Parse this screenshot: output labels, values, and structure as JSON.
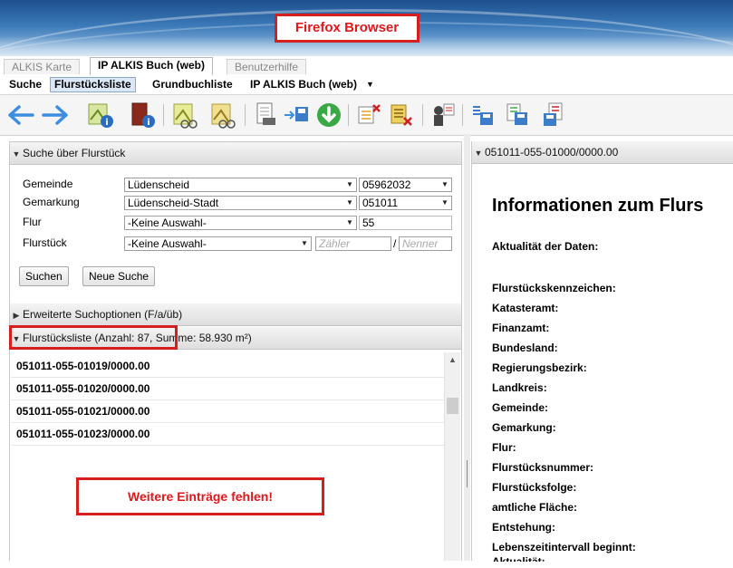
{
  "browser": {
    "label": "Firefox Browser"
  },
  "tabs": [
    {
      "label": "ALKIS Karte"
    },
    {
      "label": "IP ALKIS Buch (web)"
    },
    {
      "label": "Benutzerhilfe"
    }
  ],
  "menu": {
    "items": [
      "Suche",
      "Flurstücksliste",
      "Grundbuchliste",
      "IP ALKIS Buch (web)"
    ],
    "dropdown_icon": "chevron-down-icon"
  },
  "search_panel": {
    "title": "Suche über Flurstück",
    "fields": [
      {
        "label": "Gemeinde",
        "value": "Lüdenscheid",
        "code": "05962032"
      },
      {
        "label": "Gemarkung",
        "value": "Lüdenscheid-Stadt",
        "code": "051011"
      },
      {
        "label": "Flur",
        "value": "-Keine Auswahl-",
        "code": "55"
      },
      {
        "label": "Flurstück",
        "value": "-Keine Auswahl-",
        "zaehler_placeholder": "Zähler",
        "separator": "/",
        "nenner_placeholder": "Nenner"
      }
    ],
    "buttons": {
      "search": "Suchen",
      "new_search": "Neue Suche"
    }
  },
  "extended_options": {
    "title": "Erweiterte Suchoptionen  (F/a/üb)"
  },
  "parcel_list": {
    "title": "Flurstücksliste (Anzahl: 87, Summe: 58.930 m²)",
    "rows": [
      "051011-055-01019/0000.00",
      "051011-055-01020/0000.00",
      "051011-055-01021/0000.00",
      "051011-055-01023/0000.00"
    ],
    "missing_note": "Weitere Einträge fehlen!"
  },
  "info_panel": {
    "header": "051011-055-01000/0000.00",
    "title": "Informationen zum Flurs",
    "freshness_label": "Aktualität der Daten:",
    "labels": [
      "Flurstückskennzeichen:",
      "Katasteramt:",
      "Finanzamt:",
      "Bundesland:",
      "Regierungsbezirk:",
      "Landkreis:",
      "Gemeinde:",
      "Gemarkung:",
      "Flur:",
      "Flurstücksnummer:",
      "Flurstücksfolge:",
      "amtliche Fläche:",
      "Entstehung:",
      "Lebenszeitintervall beginnt:",
      "Aktualität:"
    ]
  },
  "colors": {
    "accent_red": "#e0181a",
    "arrow_blue": "#3d8ee0",
    "download_green": "#3aa845"
  }
}
